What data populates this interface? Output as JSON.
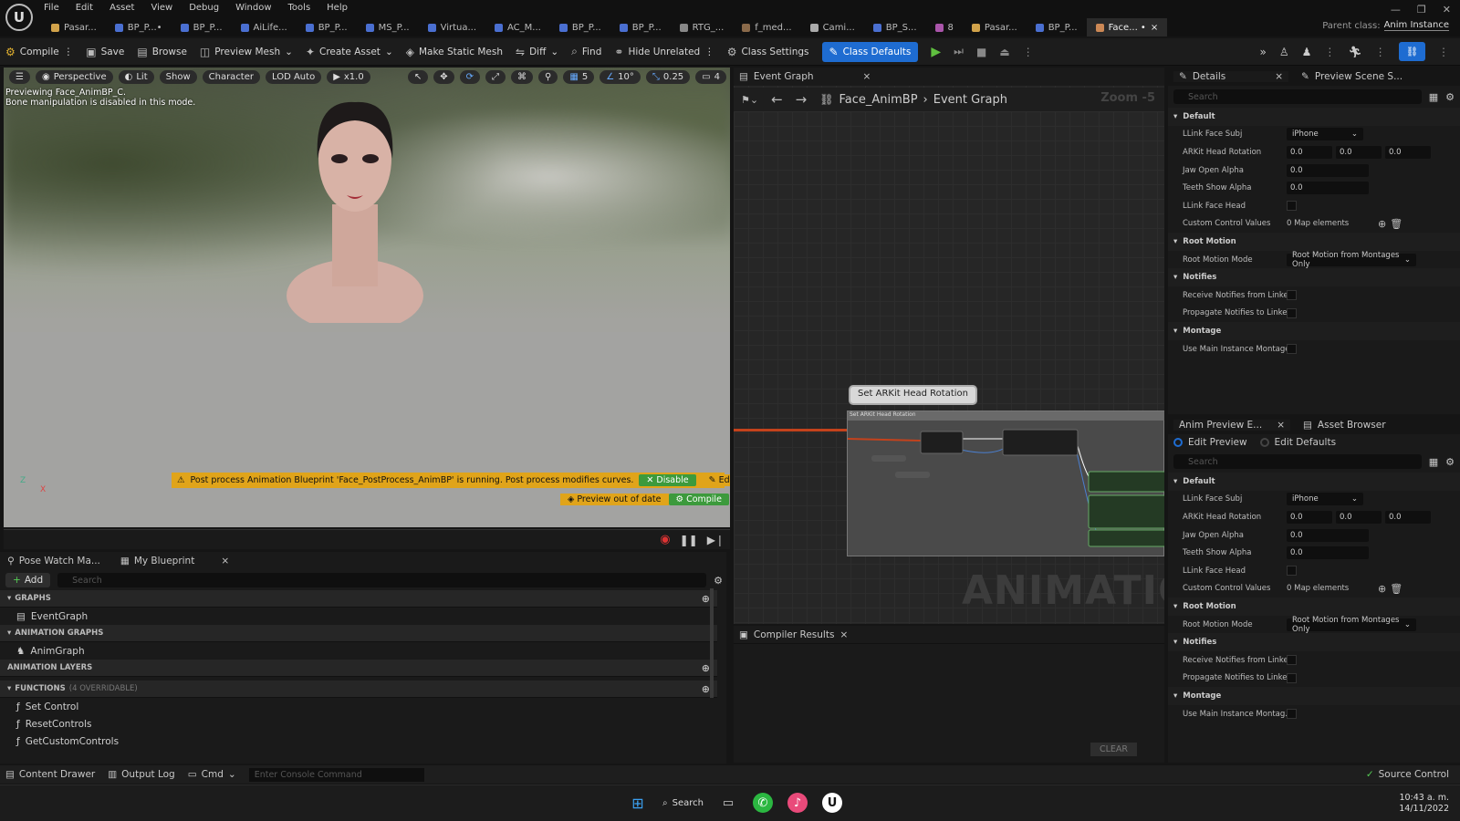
{
  "menu": [
    "File",
    "Edit",
    "Asset",
    "View",
    "Debug",
    "Window",
    "Tools",
    "Help"
  ],
  "tabs": [
    {
      "label": "Pasar..."
    },
    {
      "label": "BP_P...•"
    },
    {
      "label": "BP_P..."
    },
    {
      "label": "AiLife..."
    },
    {
      "label": "BP_P..."
    },
    {
      "label": "MS_P..."
    },
    {
      "label": "Virtua..."
    },
    {
      "label": "AC_M..."
    },
    {
      "label": "BP_P..."
    },
    {
      "label": "BP_P..."
    },
    {
      "label": "RTG_..."
    },
    {
      "label": "f_med..."
    },
    {
      "label": "Cami..."
    },
    {
      "label": "BP_S..."
    },
    {
      "label": "8"
    },
    {
      "label": "Pasar..."
    },
    {
      "label": "BP_P..."
    },
    {
      "label": "Face... •"
    }
  ],
  "parent_class": {
    "label": "Parent class:",
    "value": "Anim Instance"
  },
  "toolbar": {
    "compile": "Compile",
    "save": "Save",
    "browse": "Browse",
    "preview_mesh": "Preview Mesh",
    "create_asset": "Create Asset",
    "diff": "Diff",
    "find": "Find",
    "hide_unrelated": "Hide Unrelated",
    "class_settings": "Class Settings",
    "class_defaults": "Class Defaults"
  },
  "viewport": {
    "perspective": "Perspective",
    "lit": "Lit",
    "show": "Show",
    "character": "Character",
    "lod": "LOD Auto",
    "speed": "x1.0",
    "grid": "5",
    "angle": "10°",
    "scale": "0.25",
    "cam": "4",
    "info1": "Previewing Face_AnimBP_C.",
    "info2": "Bone manipulation is disabled in this mode.",
    "warning": "Post process Animation Blueprint 'Face_PostProcess_AnimBP' is running. Post process modifies curves.",
    "disable": "Disable",
    "edit": "Edit",
    "preview_out": "Preview out of date",
    "compile": "Compile",
    "axis_z": "Z",
    "axis_x": "X"
  },
  "blueprint": {
    "tab1": "Pose Watch Ma...",
    "tab2": "My Blueprint",
    "add": "Add",
    "search": "Search",
    "graphs": "GRAPHS",
    "event_graph": "EventGraph",
    "anim_graphs": "ANIMATION GRAPHS",
    "anim_graph": "AnimGraph",
    "anim_layers": "ANIMATION LAYERS",
    "functions": "FUNCTIONS",
    "functions_note": "(4 OVERRIDABLE)",
    "funcs": [
      "Set Control",
      "ResetControls",
      "GetCustomControls"
    ]
  },
  "graph": {
    "tab": "Event Graph",
    "crumb1": "Face_AnimBP",
    "crumb2": "Event Graph",
    "zoom": "Zoom -5",
    "comment": "Set ARKit Head Rotation",
    "node_header": "Set ARKit Head Rotation",
    "watermark": "ANIMATION"
  },
  "compiler": {
    "tab": "Compiler Results",
    "clear": "CLEAR"
  },
  "details": {
    "tab1": "Details",
    "tab2": "Preview Scene S...",
    "search": "Search",
    "default": "Default",
    "llink_subj": "LLink Face Subj",
    "llink_subj_val": "iPhone",
    "arkit": "ARKit Head Rotation",
    "arkit_vals": [
      "0.0",
      "0.0",
      "0.0"
    ],
    "jaw": "Jaw Open Alpha",
    "jaw_val": "0.0",
    "teeth": "Teeth Show Alpha",
    "teeth_val": "0.0",
    "llink_head": "LLink Face Head",
    "custom": "Custom Control Values",
    "custom_val": "0 Map elements",
    "root_motion": "Root Motion",
    "root_mode": "Root Motion Mode",
    "root_mode_val": "Root Motion from Montages Only",
    "notifies": "Notifies",
    "receive": "Receive Notifies from Linke...",
    "propagate": "Propagate Notifies to Linke...",
    "montage": "Montage",
    "use_main": "Use Main Instance Montage..."
  },
  "preview": {
    "tab1": "Anim Preview E...",
    "tab2": "Asset Browser",
    "edit_preview": "Edit Preview",
    "edit_defaults": "Edit Defaults",
    "search": "Search",
    "default": "Default",
    "llink_subj": "LLink Face Subj",
    "llink_subj_val": "iPhone",
    "arkit": "ARKit Head Rotation",
    "arkit_vals": [
      "0.0",
      "0.0",
      "0.0"
    ],
    "jaw": "Jaw Open Alpha",
    "jaw_val": "0.0",
    "teeth": "Teeth Show Alpha",
    "teeth_val": "0.0",
    "llink_head": "LLink Face Head",
    "custom": "Custom Control Values",
    "custom_val": "0 Map elements",
    "root_motion": "Root Motion",
    "root_mode": "Root Motion Mode",
    "root_mode_val": "Root Motion from Montages Only",
    "notifies": "Notifies",
    "receive": "Receive Notifies from Linke...",
    "propagate": "Propagate Notifies to Linke...",
    "montage": "Montage",
    "use_main": "Use Main Instance Montag..."
  },
  "status": {
    "content": "Content Drawer",
    "output": "Output Log",
    "cmd": "Cmd",
    "console": "Enter Console Command",
    "source": "Source Control"
  },
  "taskbar": {
    "search": "Search",
    "time": "10:43 a. m.",
    "date": "14/11/2022"
  },
  "colors": {
    "accent": "#1e6cd1",
    "play": "#5fbf3f",
    "warning": "#e0a41a",
    "compile_green": "#3c9a3c",
    "wire_red": "#c4421c"
  }
}
